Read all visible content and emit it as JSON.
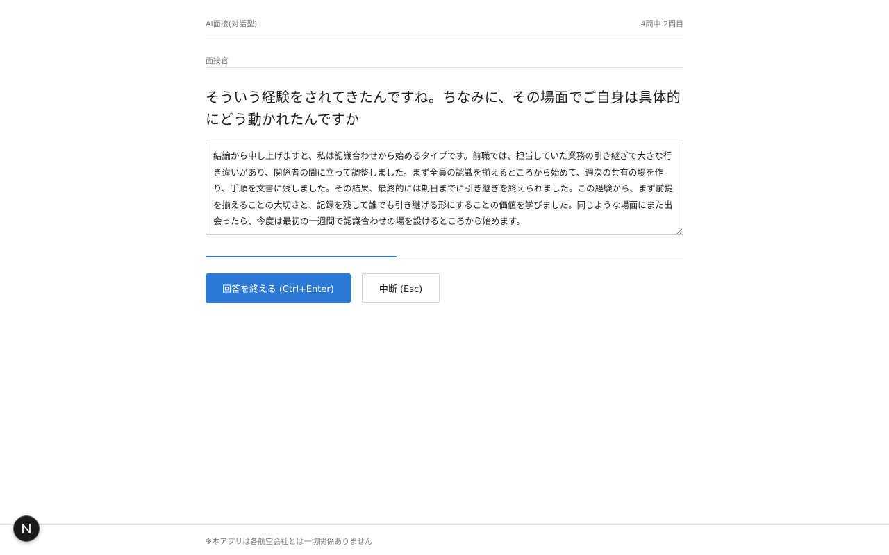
{
  "header": {
    "app_title": "AI面接(対話型)",
    "progress_text": "4問中 2問目"
  },
  "interviewer": {
    "label": "面接官",
    "question": "そういう経験をされてきたんですね。ちなみに、その場面でご自身は具体的にどう動かれたんですか"
  },
  "answer": {
    "value": "結論から申し上げますと、私は認識合わせから始めるタイプです。前職では、担当していた業務の引き継ぎで大きな行き違いがあり、関係者の間に立って調整しました。まず全員の認識を揃えるところから始めて、週次の共有の場を作り、手順を文書に残しました。その結果、最終的には期日までに引き継ぎを終えられました。この経験から、まず前提を揃えることの大切さと、記録を残して誰でも引き継げる形にすることの価値を学びました。同じような場面にまた出会ったら、今度は最初の一週間で認識合わせの場を設けるところから始めます。"
  },
  "timer_progress": {
    "fraction": 0.4
  },
  "actions": {
    "finish_label": "回答を終える (Ctrl+Enter)",
    "pause_label": "中断 (Esc)"
  },
  "footer": {
    "disclaimer": "※本アプリは各航空会社とは一切関係ありません"
  },
  "badge": {
    "icon": "next-n-icon"
  },
  "colors": {
    "accent": "#2f79d6",
    "progress": "#2f6fd6",
    "muted_text": "#7a7a7a"
  }
}
